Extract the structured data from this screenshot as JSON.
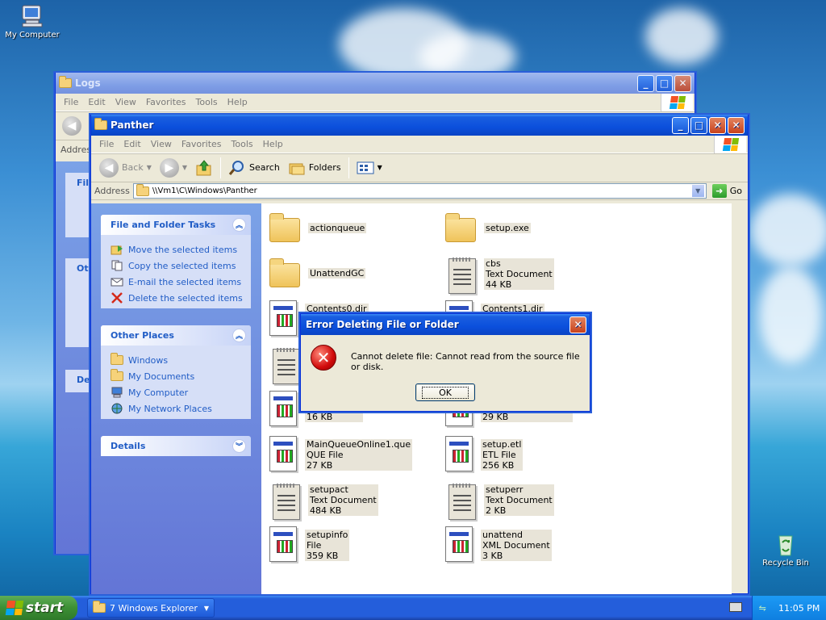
{
  "desktop": {
    "icons": [
      {
        "label": "My Computer"
      },
      {
        "label": "Recycle Bin"
      }
    ]
  },
  "logs_window": {
    "title": "Logs",
    "menu": [
      "File",
      "Edit",
      "View",
      "Favorites",
      "Tools",
      "Help"
    ],
    "address_label": "Addres",
    "panel_fragments": [
      "File",
      "Oth",
      "De"
    ]
  },
  "panther_window": {
    "title": "Panther",
    "menu": [
      "File",
      "Edit",
      "View",
      "Favorites",
      "Tools",
      "Help"
    ],
    "toolbar": {
      "back": "Back",
      "search": "Search",
      "folders": "Folders"
    },
    "address": {
      "label": "Address",
      "path": "\\\\Vm1\\C\\Windows\\Panther",
      "go": "Go"
    },
    "tasks_panel": {
      "title": "File and Folder Tasks",
      "items": [
        "Move the selected items",
        "Copy the selected items",
        "E-mail the selected items",
        "Delete the selected items"
      ]
    },
    "places_panel": {
      "title": "Other Places",
      "items": [
        "Windows",
        "My Documents",
        "My Computer",
        "My Network Places"
      ]
    },
    "details_panel": {
      "title": "Details"
    },
    "files": [
      {
        "name": "actionqueue",
        "type": "",
        "size": "",
        "icon": "folder"
      },
      {
        "name": "setup.exe",
        "type": "",
        "size": "",
        "icon": "folder"
      },
      {
        "name": "UnattendGC",
        "type": "",
        "size": "",
        "icon": "folder"
      },
      {
        "name": "cbs",
        "type": "Text Document",
        "size": "44 KB",
        "icon": "text-doc"
      },
      {
        "name": "Contents0.dir",
        "type": "",
        "size": "",
        "icon": "app-doc"
      },
      {
        "name": "Contents1.dir",
        "type": "",
        "size": "",
        "icon": "app-doc"
      },
      {
        "name": "",
        "type": "",
        "size": "",
        "icon": "text-doc"
      },
      {
        "name": "",
        "type": "",
        "size": "16 KB",
        "icon": "app-doc"
      },
      {
        "name": "",
        "type": "",
        "size": "29 KB",
        "icon": "app-doc"
      },
      {
        "name": "MainQueueOnline1.que",
        "type": "QUE File",
        "size": "27 KB",
        "icon": "app-doc"
      },
      {
        "name": "setup.etl",
        "type": "ETL File",
        "size": "256 KB",
        "icon": "app-doc"
      },
      {
        "name": "setupact",
        "type": "Text Document",
        "size": "484 KB",
        "icon": "text-doc"
      },
      {
        "name": "setuperr",
        "type": "Text Document",
        "size": "2 KB",
        "icon": "text-doc"
      },
      {
        "name": "setupinfo",
        "type": "File",
        "size": "359 KB",
        "icon": "app-doc"
      },
      {
        "name": "unattend",
        "type": "XML Document",
        "size": "3 KB",
        "icon": "app-doc"
      }
    ]
  },
  "dialog": {
    "title": "Error Deleting File or Folder",
    "message": "Cannot delete file: Cannot read from the source file or disk.",
    "ok": "OK"
  },
  "taskbar": {
    "start": "start",
    "group_button": "7 Windows Explorer",
    "clock": "11:05 PM"
  }
}
